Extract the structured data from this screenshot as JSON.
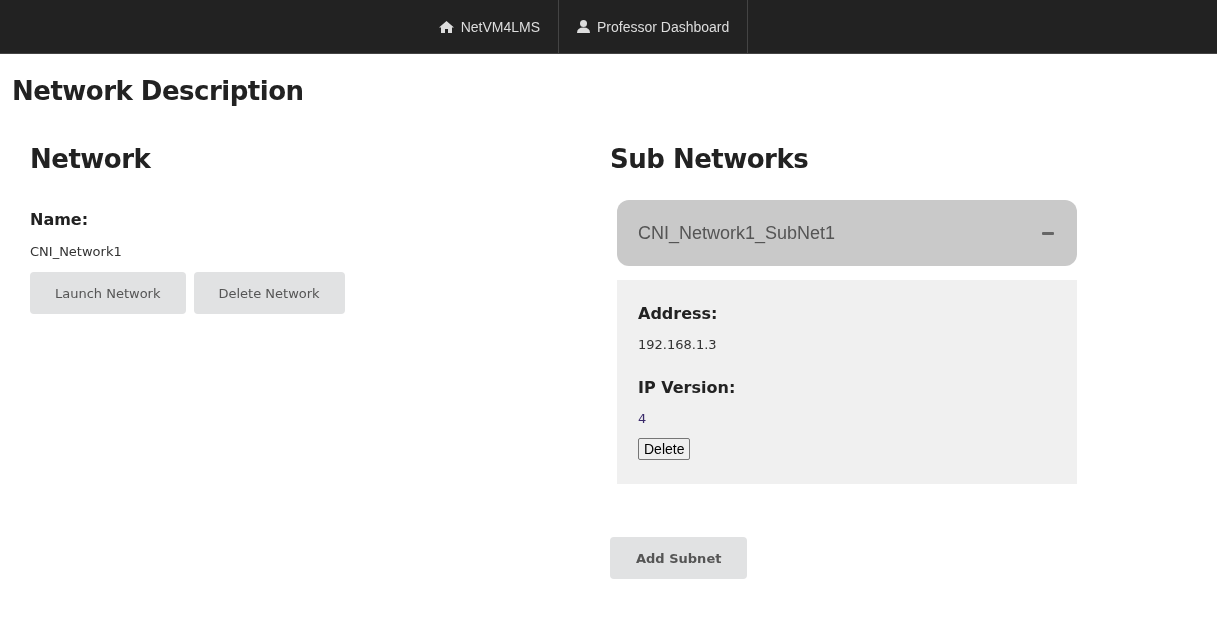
{
  "navbar": {
    "items": [
      {
        "kind": "home",
        "label": "NetVM4LMS"
      },
      {
        "kind": "user",
        "label": "Professor Dashboard"
      }
    ]
  },
  "page_title": "Network Description",
  "network": {
    "heading": "Network",
    "name_label": "Name:",
    "name": "CNI_Network1",
    "buttons": [
      "Launch Network",
      "Delete Network"
    ]
  },
  "sub_networks": {
    "heading": "Sub Networks",
    "items": [
      {
        "title": "CNI_Network1_SubNet1",
        "expanded": true,
        "address_label": "Address:",
        "address": "192.168.1.3",
        "ip_version_label": "IP Version:",
        "ip_version": "4",
        "delete_button": "Delete"
      }
    ],
    "add_button": "Add Subnet"
  }
}
